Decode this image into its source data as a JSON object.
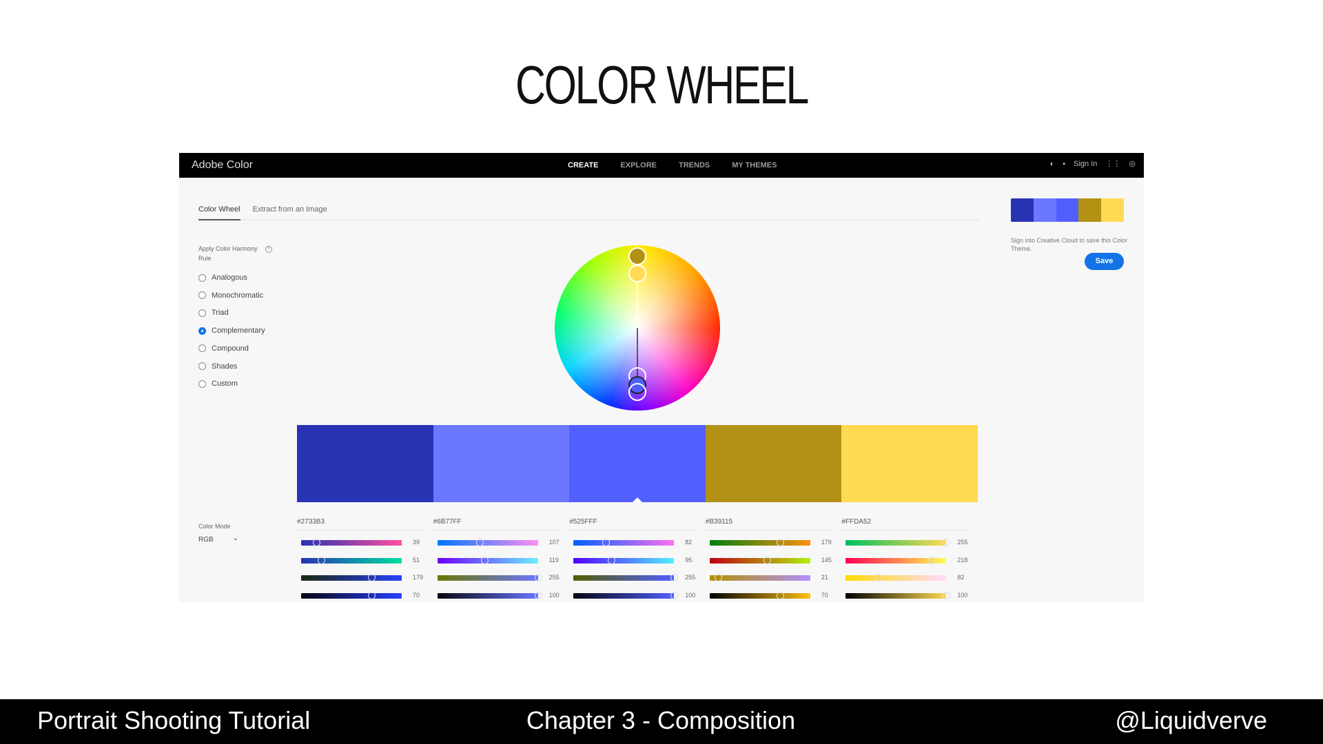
{
  "slide": {
    "title": "COLOR WHEEL"
  },
  "app": {
    "brand": "Adobe Color",
    "nav": [
      {
        "label": "CREATE",
        "active": true
      },
      {
        "label": "EXPLORE"
      },
      {
        "label": "TRENDS"
      },
      {
        "label": "MY THEMES"
      }
    ],
    "topright": {
      "sign_in": "Sign In",
      "icons": [
        "theme-toggle-icon",
        "chat-icon",
        "apps-grid-icon",
        "creative-cloud-icon"
      ]
    },
    "tabs": [
      {
        "label": "Color Wheel",
        "active": true
      },
      {
        "label": "Extract from an Image"
      }
    ],
    "harmony": {
      "label": "Apply Color Harmony Rule",
      "help": "?",
      "options": [
        "Analogous",
        "Monochromatic",
        "Triad",
        "Complementary",
        "Compound",
        "Shades",
        "Custom"
      ],
      "selected": "Complementary"
    },
    "color_mode": {
      "label": "Color Mode",
      "value": "RGB"
    },
    "swatches": [
      {
        "hex": "#2733B3",
        "values": [
          39,
          51,
          179,
          70
        ],
        "grads": [
          [
            "#2733b3",
            "#ff4fa0"
          ],
          [
            "#2733b3",
            "#00e0a0"
          ],
          [
            "#1a2a10",
            "#2840ff"
          ],
          [
            "#050510",
            "#2840ff"
          ]
        ]
      },
      {
        "hex": "#6B77FF",
        "values": [
          107,
          119,
          255,
          100
        ],
        "grads": [
          [
            "#0077ff",
            "#ff90f0"
          ],
          [
            "#6a00ff",
            "#6bf0ff"
          ],
          [
            "#6b7700",
            "#6b77ff"
          ],
          [
            "#050510",
            "#6b77ff"
          ]
        ]
      },
      {
        "hex": "#525FFF",
        "values": [
          82,
          95,
          255,
          100
        ],
        "grads": [
          [
            "#005fff",
            "#ff70f0"
          ],
          [
            "#5200ff",
            "#52f0ff"
          ],
          [
            "#525f00",
            "#525fff"
          ],
          [
            "#050510",
            "#525fff"
          ]
        ]
      },
      {
        "hex": "#B39115",
        "values": [
          179,
          145,
          21,
          70
        ],
        "grads": [
          [
            "#008010",
            "#ff9010"
          ],
          [
            "#c00010",
            "#b0f010"
          ],
          [
            "#b39100",
            "#b390ff"
          ],
          [
            "#000000",
            "#ffc010"
          ]
        ]
      },
      {
        "hex": "#FFDA52",
        "values": [
          255,
          218,
          82,
          100
        ],
        "grads": [
          [
            "#00c060",
            "#ffda52"
          ],
          [
            "#ff0052",
            "#ffff52"
          ],
          [
            "#ffda00",
            "#ffdaff"
          ],
          [
            "#000000",
            "#ffda52"
          ]
        ]
      }
    ],
    "selected_swatch": 2,
    "right_panel": {
      "message": "Sign into Creative Cloud to save this Color Theme.",
      "save": "Save"
    }
  },
  "footer": {
    "left": "Portrait Shooting Tutorial",
    "center": "Chapter 3 - Composition",
    "right": "@Liquidverve"
  }
}
